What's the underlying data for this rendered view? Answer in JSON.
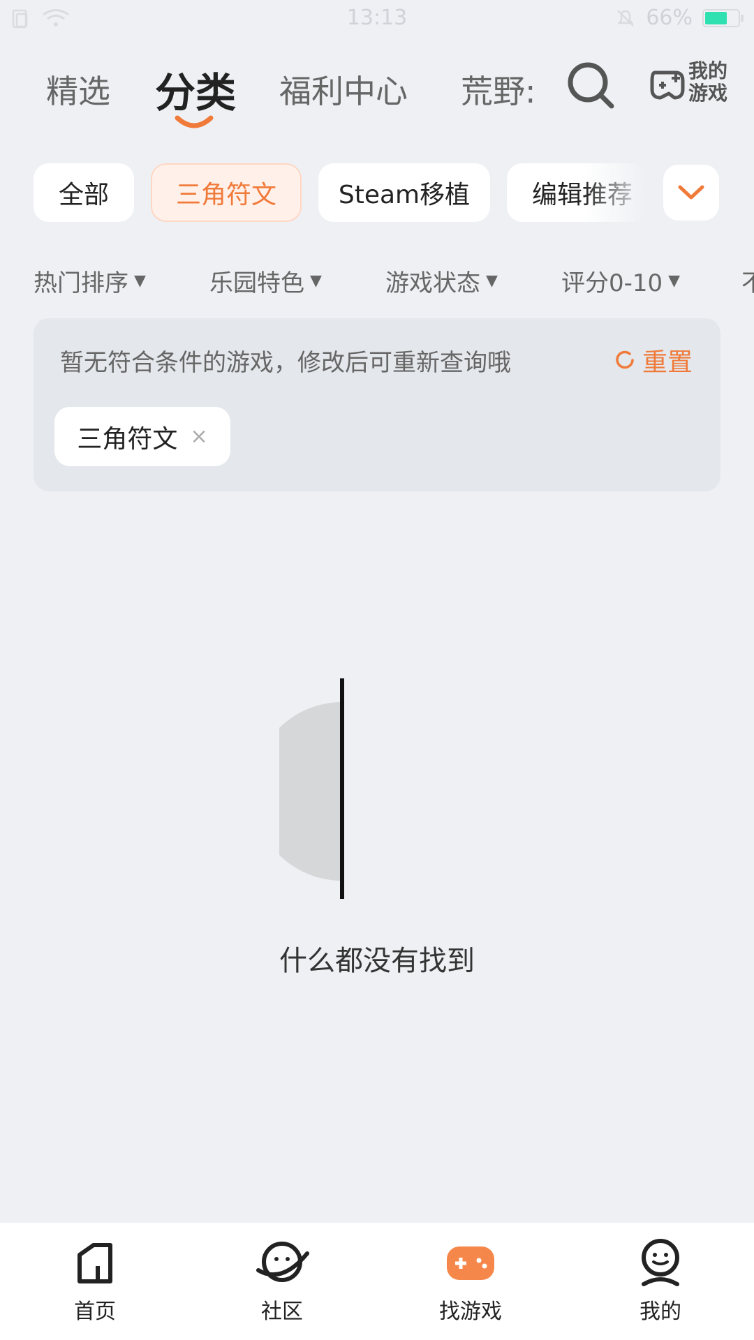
{
  "status_bar": {
    "time": "13:13",
    "battery": "66%"
  },
  "top_tabs": [
    {
      "label": "精选"
    },
    {
      "label": "分类"
    },
    {
      "label": "福利中心"
    },
    {
      "label": "荒野:"
    }
  ],
  "my_games": {
    "line1": "我的",
    "line2": "游戏"
  },
  "chips": [
    {
      "label": "全部"
    },
    {
      "label": "三角符文"
    },
    {
      "label": "Steam移植"
    },
    {
      "label": "编辑推荐"
    }
  ],
  "filters": [
    {
      "label": "热门排序"
    },
    {
      "label": "乐园特色"
    },
    {
      "label": "游戏状态"
    },
    {
      "label": "评分0-10"
    },
    {
      "label": "不"
    }
  ],
  "panel": {
    "message": "暂无符合条件的游戏，修改后可重新查询哦",
    "reset_label": "重置",
    "tag_label": "三角符文",
    "tag_close": "×"
  },
  "empty_text": "什么都没有找到",
  "bottom_nav": [
    {
      "label": "首页"
    },
    {
      "label": "社区"
    },
    {
      "label": "找游戏"
    },
    {
      "label": "我的"
    }
  ],
  "colors": {
    "accent": "#f07a3a",
    "background": "#eef0f4"
  }
}
